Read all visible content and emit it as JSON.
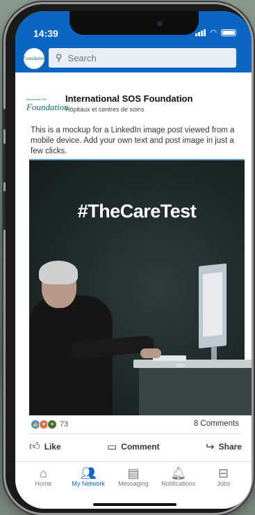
{
  "status_bar": {
    "time": "14:39"
  },
  "search": {
    "placeholder": "Search"
  },
  "header": {
    "logo_text": "Foundation"
  },
  "post": {
    "author_logo_small": "International SOS",
    "author_logo_text": "Foundation",
    "author_name": "International SOS Foundation",
    "author_subtitle": "Hôpitaux et centres de soins",
    "body": "This is a mockup for a LinkedIn image post viewed from a mobile device. Add your own text and post image in just a few clicks.",
    "image_caption": "#TheCareTest",
    "reaction_count": "73",
    "comment_count": "8 Comments",
    "actions": {
      "like": "Like",
      "comment": "Comment",
      "share": "Share"
    }
  },
  "nav": {
    "items": [
      {
        "label": "Home",
        "icon": "home-icon"
      },
      {
        "label": "My Network",
        "icon": "network-icon"
      },
      {
        "label": "Messaging",
        "icon": "messaging-icon"
      },
      {
        "label": "Notifications",
        "icon": "bell-icon"
      },
      {
        "label": "Jobs",
        "icon": "briefcase-icon"
      }
    ],
    "active": "My Network"
  },
  "colors": {
    "brand": "#0a66c2",
    "foundation_green": "#0b6e52"
  }
}
